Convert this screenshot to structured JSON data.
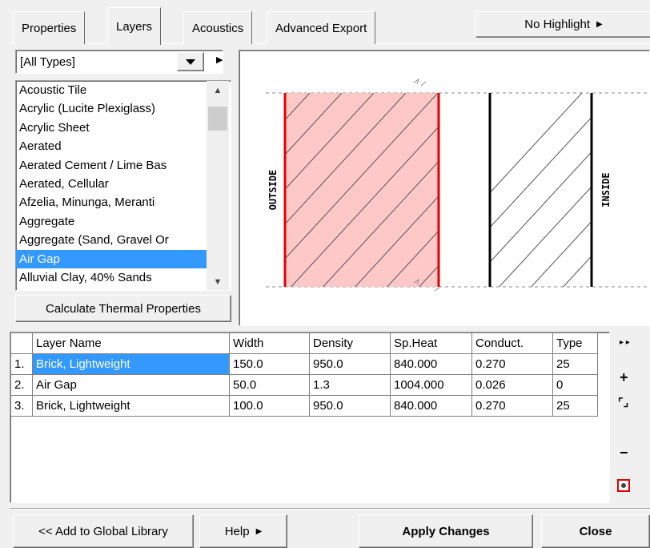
{
  "tabs": [
    {
      "label": "Properties",
      "active": false
    },
    {
      "label": "Layers",
      "active": true
    },
    {
      "label": "Acoustics",
      "active": false
    },
    {
      "label": "Advanced Export",
      "active": false
    }
  ],
  "highlight_button": "No Highlight",
  "type_filter": {
    "selected": "[All Types]"
  },
  "materials": [
    "Acoustic Tile",
    "Acrylic (Lucite Plexiglass)",
    "Acrylic Sheet",
    "Aerated",
    "Aerated Cement / Lime Bas",
    "Aerated, Cellular",
    "Afzelia, Minunga, Meranti",
    "Aggregate",
    "Aggregate (Sand, Gravel Or",
    "Air Gap",
    "Alluvial Clay, 40% Sands"
  ],
  "selected_material": "Air Gap",
  "calc_button": "Calculate Thermal Properties",
  "diagram": {
    "outside_label": "OUTSIDE",
    "inside_label": "INSIDE",
    "colors": {
      "highlight_fill": "#ffc8c8",
      "highlight_border": "#e00000",
      "line": "#000000"
    }
  },
  "layers_table": {
    "columns": [
      "Layer Name",
      "Width",
      "Density",
      "Sp.Heat",
      "Conduct.",
      "Type"
    ],
    "rows": [
      {
        "num": "1.",
        "name": "Brick, Lightweight",
        "width": "150.0",
        "density": "950.0",
        "sp_heat": "840.000",
        "conduct": "0.270",
        "type": "25"
      },
      {
        "num": "2.",
        "name": "Air Gap",
        "width": "50.0",
        "density": "1.3",
        "sp_heat": "1004.000",
        "conduct": "0.026",
        "type": "0"
      },
      {
        "num": "3.",
        "name": "Brick, Lightweight",
        "width": "100.0",
        "density": "950.0",
        "sp_heat": "840.000",
        "conduct": "0.270",
        "type": "25"
      }
    ]
  },
  "side_tools": {
    "more": "▸ ▸",
    "add": "+",
    "select": "⌜⌟",
    "remove": "−"
  },
  "bottom_buttons": {
    "add_library": "<< Add to Global Library",
    "help": "Help",
    "apply": "Apply Changes",
    "close": "Close"
  }
}
